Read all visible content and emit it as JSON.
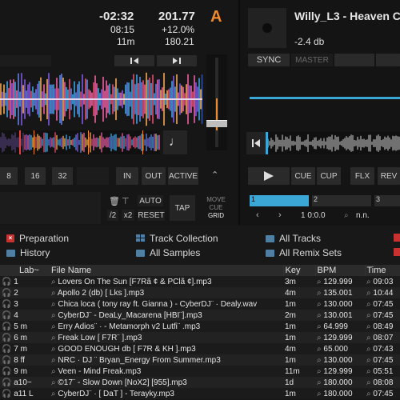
{
  "deck_a": {
    "letter": "A",
    "remaining": "-02:32",
    "elapsed": "08:15",
    "length": "11m",
    "bpm": "201.77",
    "pitch": "+12.0%",
    "orig_bpm": "180.21",
    "loop_sizes": [
      "8",
      "16",
      "32"
    ],
    "in_label": "IN",
    "out_label": "OUT",
    "active_label": "ACTIVE",
    "auto_label": "AUTO",
    "reset_label": "RESET",
    "div_label": "/2",
    "mul_label": "x2",
    "tap_label": "TAP",
    "move_label": "MOVE",
    "cue_label": "CUE",
    "grid_label": "GRID"
  },
  "deck_b": {
    "title": "Willy_L3 - Heaven C",
    "gain": "-2.4 db",
    "sync_label": "SYNC",
    "master_label": "MASTER",
    "cue_label": "CUE",
    "cup_label": "CUP",
    "flx_label": "FLX",
    "rev_label": "REV",
    "beat_1": "1",
    "beat_2": "2",
    "beat_3": "3",
    "position": "1 0:0.0",
    "key": "n.n."
  },
  "browser": {
    "favorites": [
      {
        "label": "Preparation",
        "icon": "x"
      },
      {
        "label": "Track Collection",
        "icon": "grid"
      },
      {
        "label": "All Tracks",
        "icon": "folder"
      },
      {
        "label": "History",
        "icon": "folder"
      },
      {
        "label": "All Samples",
        "icon": "folder"
      },
      {
        "label": "All Remix Sets",
        "icon": "folder"
      }
    ],
    "columns": {
      "label": "Lab~",
      "file": "File Name",
      "key": "Key",
      "bpm": "BPM",
      "time": "Time"
    },
    "rows": [
      {
        "num": "1",
        "file": "Lovers On The Sun [F7Rã ¢ & PClã ¢].mp3",
        "key": "3m",
        "bpm": "129.999",
        "time": "09:03"
      },
      {
        "num": "2",
        "file": "Apollo 2 (db) [ Lks ].mp3",
        "key": "4m",
        "bpm": "135.001",
        "time": "10:44"
      },
      {
        "num": "3",
        "file": "Chica loca ( tony ray ft. Gianna ) - CyberDJ¨ · Dealy.wav",
        "key": "1m",
        "bpm": "130.000",
        "time": "07:45"
      },
      {
        "num": "4",
        "file": "CyberDJ¨ - DeaLy_Macarena [HBI¨].mp3",
        "key": "2m",
        "bpm": "130.001",
        "time": "07:45"
      },
      {
        "num": "5 m",
        "file": "Erry Adios¨ · - Metamorph v2  Lutfi¨ .mp3",
        "key": "1m",
        "bpm": "64.999",
        "time": "08:49"
      },
      {
        "num": "6 m",
        "file": "Freak Low [ F7R¨ ].mp3",
        "key": "1m",
        "bpm": "129.999",
        "time": "08:07"
      },
      {
        "num": "7 m",
        "file": "GOOD ENOUGH db [ F7R & KH ].mp3",
        "key": "4m",
        "bpm": "65.000",
        "time": "07:43"
      },
      {
        "num": "8 ff",
        "file": "NRC · DJ ¨ Bryan_Energy From Summer.mp3",
        "key": "1m",
        "bpm": "130.000",
        "time": "07:45"
      },
      {
        "num": "9 m",
        "file": "Veen - Mind Freak.mp3",
        "key": "11m",
        "bpm": "129.999",
        "time": "05:51"
      },
      {
        "num": "a10~",
        "file": "©17¨ - Slow Down [NoX2] [955].mp3",
        "key": "1d",
        "bpm": "180.000",
        "time": "08:08"
      },
      {
        "num": "a11 L",
        "file": "CyberDJ¨ · [ DaT ] - Terayky.mp3",
        "key": "1m",
        "bpm": "180.000",
        "time": "07:45"
      }
    ]
  },
  "colors": {
    "accent": "#f08a2c",
    "deck_b_blue": "#3aa7d6",
    "delete_red": "#c93030",
    "folder_blue": "#4f7fa3"
  }
}
